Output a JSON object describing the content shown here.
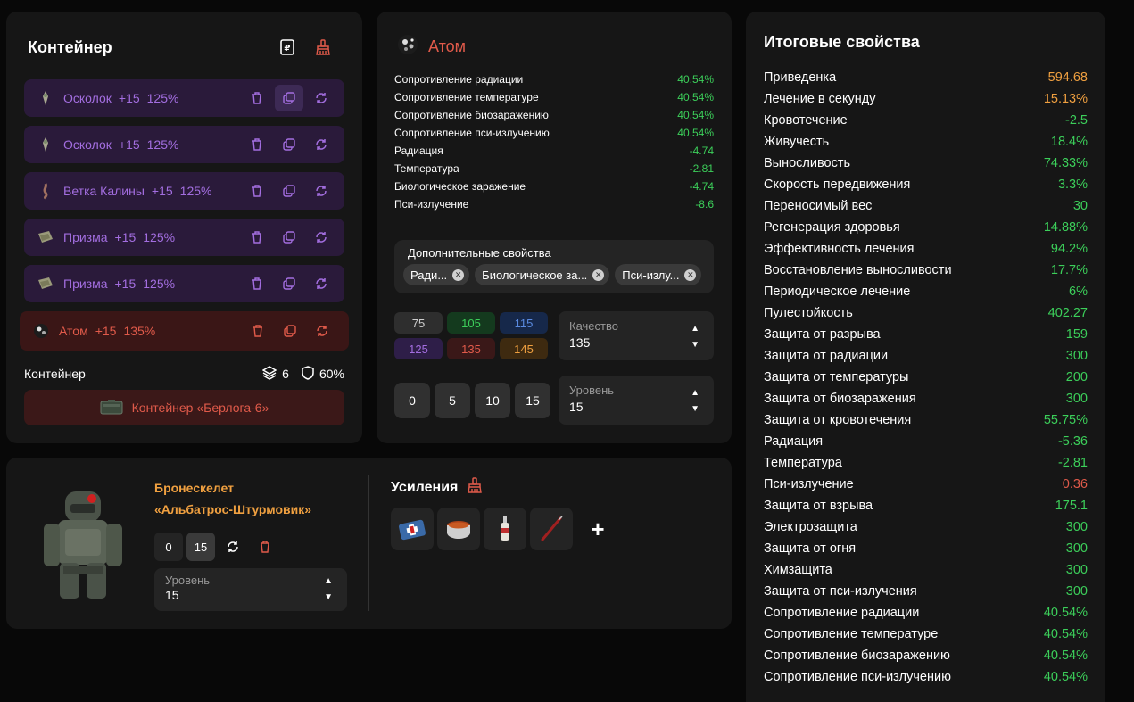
{
  "container": {
    "title": "Контейнер",
    "artifacts": [
      {
        "name": "Осколок",
        "level": "+15",
        "quality": "125%",
        "active": false
      },
      {
        "name": "Осколок",
        "level": "+15",
        "quality": "125%",
        "active": false
      },
      {
        "name": "Ветка Калины",
        "level": "+15",
        "quality": "125%",
        "active": false
      },
      {
        "name": "Призма",
        "level": "+15",
        "quality": "125%",
        "active": false
      },
      {
        "name": "Призма",
        "level": "+15",
        "quality": "125%",
        "active": false
      },
      {
        "name": "Атом",
        "level": "+15",
        "quality": "135%",
        "active": true
      }
    ],
    "footer_label": "Контейнер",
    "slots": "6",
    "protection": "60%",
    "container_button": "Контейнер «Берлога-6»"
  },
  "artifact": {
    "title": "Атом",
    "properties": [
      {
        "name": "Сопротивление радиации",
        "value": "40.54%"
      },
      {
        "name": "Сопротивление температуре",
        "value": "40.54%"
      },
      {
        "name": "Сопротивление биозаражению",
        "value": "40.54%"
      },
      {
        "name": "Сопротивление пси-излучению",
        "value": "40.54%"
      },
      {
        "name": "Радиация",
        "value": "-4.74"
      },
      {
        "name": "Температура",
        "value": "-2.81"
      },
      {
        "name": "Биологическое заражение",
        "value": "-4.74"
      },
      {
        "name": "Пси-излучение",
        "value": "-8.6"
      }
    ],
    "extra_label": "Дополнительные свойства",
    "extra_chips": [
      "Ради...",
      "Биологическое за...",
      "Пси-излу..."
    ],
    "quality_buttons": [
      {
        "label": "75",
        "bg": "#2e2e2e",
        "fg": "#cfcfcf"
      },
      {
        "label": "105",
        "bg": "#143a1e",
        "fg": "#3ccf5a"
      },
      {
        "label": "115",
        "bg": "#16284a",
        "fg": "#5a8ae0"
      },
      {
        "label": "125",
        "bg": "#2e1e48",
        "fg": "#a36ee0"
      },
      {
        "label": "135",
        "bg": "#3a1818",
        "fg": "#e05a4a"
      },
      {
        "label": "145",
        "bg": "#3e2a10",
        "fg": "#f0a040"
      }
    ],
    "quality_select": {
      "label": "Качество",
      "value": "135"
    },
    "level_buttons": [
      "0",
      "5",
      "10",
      "15"
    ],
    "level_select": {
      "label": "Уровень",
      "value": "15"
    }
  },
  "armor": {
    "name_line1": "Бронескелет",
    "name_line2": "«Альбатрос-Штурмовик»",
    "level_buttons": [
      "0",
      "15"
    ],
    "level_select": {
      "label": "Уровень",
      "value": "15"
    },
    "boosts_title": "Усиления",
    "add_label": "+"
  },
  "totals": {
    "title": "Итоговые свойства",
    "rows": [
      {
        "name": "Приведенка",
        "value": "594.68",
        "color": "orange"
      },
      {
        "name": "Лечение в секунду",
        "value": "15.13%",
        "color": "orange"
      },
      {
        "name": "Кровотечение",
        "value": "-2.5",
        "color": "green"
      },
      {
        "name": "Живучесть",
        "value": "18.4%",
        "color": "green"
      },
      {
        "name": "Выносливость",
        "value": "74.33%",
        "color": "green"
      },
      {
        "name": "Скорость передвижения",
        "value": "3.3%",
        "color": "green"
      },
      {
        "name": "Переносимый вес",
        "value": "30",
        "color": "green"
      },
      {
        "name": "Регенерация здоровья",
        "value": "14.88%",
        "color": "green"
      },
      {
        "name": "Эффективность лечения",
        "value": "94.2%",
        "color": "green"
      },
      {
        "name": "Восстановление выносливости",
        "value": "17.7%",
        "color": "green"
      },
      {
        "name": "Периодическое лечение",
        "value": "6%",
        "color": "green"
      },
      {
        "name": "Пулестойкость",
        "value": "402.27",
        "color": "green"
      },
      {
        "name": "Защита от разрыва",
        "value": "159",
        "color": "green"
      },
      {
        "name": "Защита от радиации",
        "value": "300",
        "color": "green"
      },
      {
        "name": "Защита от температуры",
        "value": "200",
        "color": "green"
      },
      {
        "name": "Защита от биозаражения",
        "value": "300",
        "color": "green"
      },
      {
        "name": "Защита от кровотечения",
        "value": "55.75%",
        "color": "green"
      },
      {
        "name": "Радиация",
        "value": "-5.36",
        "color": "green"
      },
      {
        "name": "Температура",
        "value": "-2.81",
        "color": "green"
      },
      {
        "name": "Пси-излучение",
        "value": "0.36",
        "color": "red"
      },
      {
        "name": "Защита от взрыва",
        "value": "175.1",
        "color": "green"
      },
      {
        "name": "Электрозащита",
        "value": "300",
        "color": "green"
      },
      {
        "name": "Защита от огня",
        "value": "300",
        "color": "green"
      },
      {
        "name": "Химзащита",
        "value": "300",
        "color": "green"
      },
      {
        "name": "Защита от пси-излучения",
        "value": "300",
        "color": "green"
      },
      {
        "name": "Сопротивление радиации",
        "value": "40.54%",
        "color": "green"
      },
      {
        "name": "Сопротивление температуре",
        "value": "40.54%",
        "color": "green"
      },
      {
        "name": "Сопротивление биозаражению",
        "value": "40.54%",
        "color": "green"
      },
      {
        "name": "Сопротивление пси-излучению",
        "value": "40.54%",
        "color": "green"
      }
    ]
  }
}
